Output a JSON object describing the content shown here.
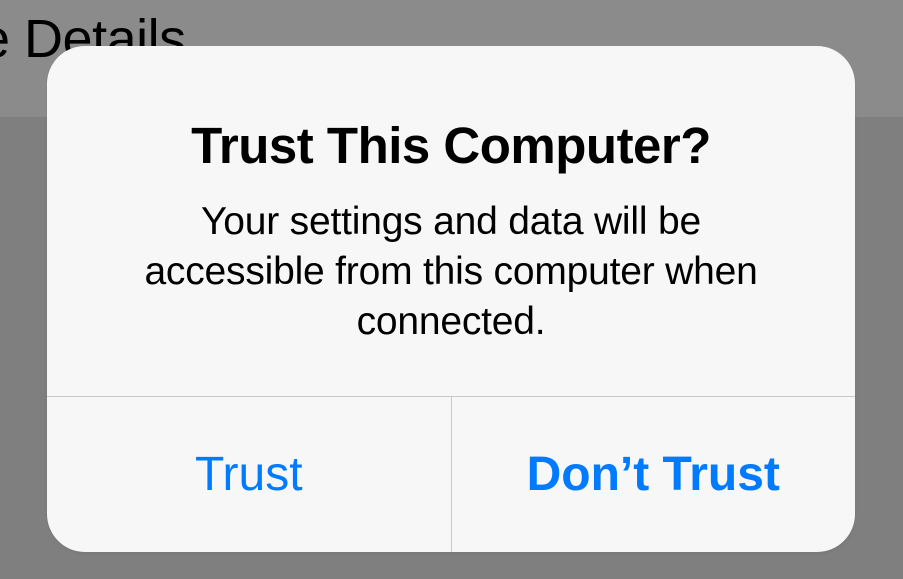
{
  "background": {
    "partial_text": "e Details"
  },
  "dialog": {
    "title": "Trust This Computer?",
    "message": "Your settings and data will be accessible from this computer when connected.",
    "buttons": {
      "trust": "Trust",
      "dont_trust": "Don’t Trust"
    }
  },
  "colors": {
    "accent": "#007aff",
    "dialog_bg": "#f7f7f7",
    "divider": "#c9c9ca",
    "backdrop_upper": "#8b8b8c",
    "backdrop_lower": "#7f7f80"
  }
}
